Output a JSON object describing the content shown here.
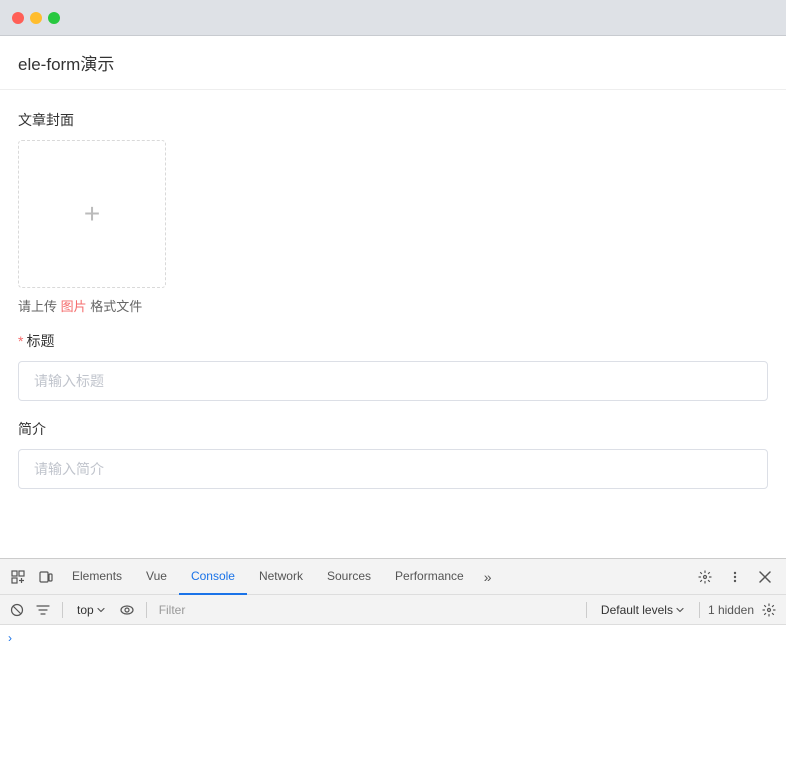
{
  "browser": {
    "dots": [
      "red",
      "yellow",
      "green"
    ]
  },
  "page": {
    "title": "ele-form演示",
    "cover_label": "文章封面",
    "upload_hint_pre": "请上传 ",
    "upload_hint_red": "图片",
    "upload_hint_post": " 格式文件",
    "title_label": "标题",
    "title_placeholder": "请输入标题",
    "intro_label": "简介",
    "intro_placeholder": "请输入简介"
  },
  "devtools": {
    "tabs": [
      {
        "id": "elements",
        "label": "Elements",
        "active": false
      },
      {
        "id": "vue",
        "label": "Vue",
        "active": false
      },
      {
        "id": "console",
        "label": "Console",
        "active": true
      },
      {
        "id": "network",
        "label": "Network",
        "active": false
      },
      {
        "id": "sources",
        "label": "Sources",
        "active": false
      },
      {
        "id": "performance",
        "label": "Performance",
        "active": false
      }
    ],
    "more_label": "»",
    "toolbar": {
      "context": "top",
      "filter_placeholder": "Filter",
      "levels_label": "Default levels",
      "hidden_count": "1 hidden"
    }
  }
}
